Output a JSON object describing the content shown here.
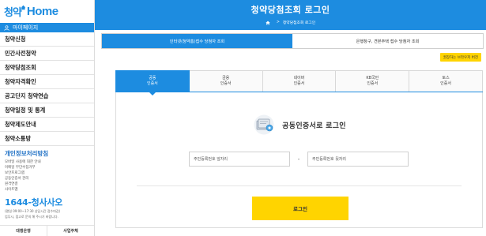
{
  "sidebar": {
    "logo_kor": "청약",
    "logo_eng": "Home",
    "mypage": "마이페이지",
    "menu": [
      "청약신청",
      "민간사전청약",
      "청약당첨조회",
      "청약자격확인",
      "공고단지 청약연습",
      "청약일정 및 통계",
      "청약제도안내",
      "청약소통방"
    ],
    "privacy_title": "개인정보처리방침",
    "privacy_links": [
      "모바일 사용에 대한 안내",
      "이메일 무단수집거부",
      "보안프로그램",
      "공동인증서 관리",
      "원격연결",
      "사이트맵"
    ],
    "call_number": "1644-청사사오",
    "call_info": [
      "(평일 09:00~17:30 상담시간 접수마감)",
      "업무시, 점고로 문의 해 주시기 바랍니다."
    ],
    "bottom_links": [
      "대행은행",
      "사업주체"
    ]
  },
  "header": {
    "title": "청약당첨조회 로그인",
    "breadcrumb_sep": ">",
    "breadcrumb_current": "청약당첨조회 로그인"
  },
  "top_tabs": [
    "인터넷(청약홈)접수 당첨자 조회",
    "은행창구, 견본주택 접수 당첨자 조회"
  ],
  "tip_badge": "권장하는 브라우저 버전",
  "cert_tabs": [
    {
      "line1": "공동",
      "line2": "인증서"
    },
    {
      "line1": "금융",
      "line2": "인증서"
    },
    {
      "line1": "네이버",
      "line2": "인증서"
    },
    {
      "line1": "KB국민",
      "line2": "인증서"
    },
    {
      "line1": "토스",
      "line2": "인증서"
    }
  ],
  "login": {
    "heading": "공동인증서로 로그인",
    "rrn_front_placeholder": "주민등록번호 앞자리",
    "rrn_back_placeholder": "주민등록번호 뒷자리",
    "dash": "-",
    "button": "로그인"
  },
  "colors": {
    "primary": "#1d8ce0",
    "accent": "#ffd400"
  }
}
